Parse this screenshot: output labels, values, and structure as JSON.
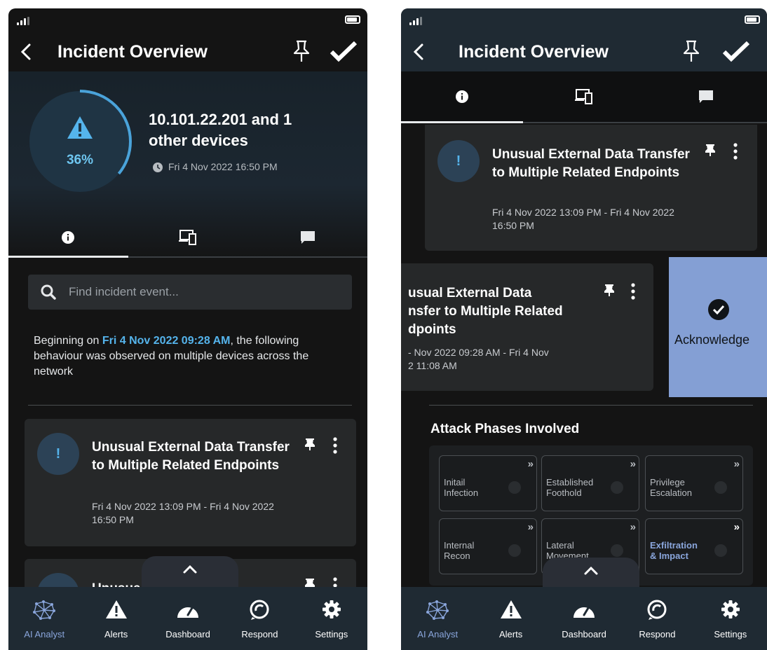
{
  "left": {
    "title": "Incident Overview",
    "ring_percent": "36%",
    "ring_level": 0.36,
    "devices_line1": "10.101.22.201 and 1",
    "devices_line2": "other devices",
    "time": "Fri 4 Nov 2022 16:50 PM",
    "search_placeholder": "Find incident event...",
    "desc_prefix": "Beginning on ",
    "desc_date": "Fri 4 Nov 2022 09:28 AM",
    "desc_suffix": ", the following behaviour was observed on multiple devices across the network",
    "card1": {
      "badge": "!",
      "title": "Unusual External Data Transfer to Multiple Related Endpoints",
      "date": "Fri 4 Nov 2022 13:09 PM - Fri 4 Nov 2022 16:50 PM"
    },
    "card2_title_partial": "Unusua"
  },
  "right": {
    "title": "Incident Overview",
    "card1": {
      "badge": "!",
      "title": "Unusual External Data Transfer to Multiple Related Endpoints",
      "date": "Fri 4 Nov 2022 13:09 PM - Fri 4 Nov 2022 16:50 PM"
    },
    "card2": {
      "title_line1": "usual External Data",
      "title_line2": "nsfer to Multiple Related",
      "title_line3": "dpoints",
      "date_line1": "- Nov 2022 09:28 AM - Fri 4 Nov",
      "date_line2": "2 11:08 AM"
    },
    "acknowledge_label": "Acknowledge",
    "phases_title": "Attack Phases Involved",
    "phases": [
      {
        "label": "Initail\nInfection",
        "highlight": false
      },
      {
        "label": "Established\nFoothold",
        "highlight": false
      },
      {
        "label": "Privilege\nEscalation",
        "highlight": false
      },
      {
        "label": "Internal\nRecon",
        "highlight": false
      },
      {
        "label": "Lateral\nMovement",
        "highlight": false
      },
      {
        "label": "Exfiltration\n& Impact",
        "highlight": true
      }
    ]
  },
  "nav": {
    "items": [
      "AI Analyst",
      "Alerts",
      "Dashboard",
      "Respond",
      "Settings"
    ],
    "active": "AI Analyst"
  },
  "colors": {
    "accent": "#55b4ec",
    "active_nav": "#8aa6dc",
    "acknowledge_panel": "#849fd4",
    "background": "#141414"
  }
}
